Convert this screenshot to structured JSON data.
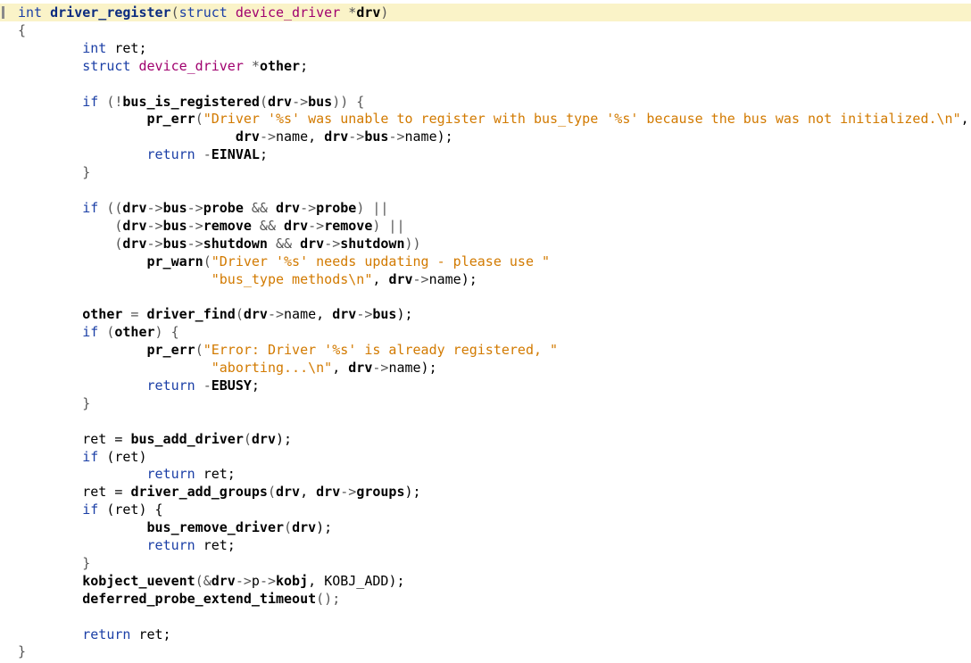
{
  "editor": {
    "colors": {
      "keyword": "#1b3fa6",
      "type_name": "#a0006e",
      "function_definition": "#0b2b80",
      "identifier": "#000000",
      "string": "#d27a00",
      "current_line_highlight": "#faf3c8"
    },
    "lines": [
      [
        {
          "t": "int ",
          "c": "kw"
        },
        {
          "t": "driver_register",
          "c": "fn"
        },
        {
          "t": "(",
          "c": "op"
        },
        {
          "t": "struct ",
          "c": "kw"
        },
        {
          "t": "device_driver ",
          "c": "typ"
        },
        {
          "t": "*",
          "c": "op"
        },
        {
          "t": "drv",
          "c": "id"
        },
        {
          "t": ")",
          "c": "op"
        }
      ],
      [
        {
          "t": "{",
          "c": "op"
        }
      ],
      [
        {
          "t": "        ",
          "c": "pl"
        },
        {
          "t": "int ",
          "c": "kw"
        },
        {
          "t": "ret;",
          "c": "pl"
        }
      ],
      [
        {
          "t": "        ",
          "c": "pl"
        },
        {
          "t": "struct ",
          "c": "kw"
        },
        {
          "t": "device_driver ",
          "c": "typ"
        },
        {
          "t": "*",
          "c": "op"
        },
        {
          "t": "other",
          "c": "id"
        },
        {
          "t": ";",
          "c": "pl"
        }
      ],
      [],
      [
        {
          "t": "        ",
          "c": "pl"
        },
        {
          "t": "if ",
          "c": "kw"
        },
        {
          "t": "(!",
          "c": "op"
        },
        {
          "t": "bus_is_registered",
          "c": "id"
        },
        {
          "t": "(",
          "c": "op"
        },
        {
          "t": "drv",
          "c": "id"
        },
        {
          "t": "->",
          "c": "op"
        },
        {
          "t": "bus",
          "c": "id"
        },
        {
          "t": ")) {",
          "c": "op"
        }
      ],
      [
        {
          "t": "                ",
          "c": "pl"
        },
        {
          "t": "pr_err",
          "c": "id"
        },
        {
          "t": "(",
          "c": "op"
        },
        {
          "t": "\"Driver '%s' was unable to register with bus_type '%s' because the bus was not initialized.\\n\"",
          "c": "str"
        },
        {
          "t": ",",
          "c": "pl"
        }
      ],
      [
        {
          "t": "                           ",
          "c": "pl"
        },
        {
          "t": "drv",
          "c": "id"
        },
        {
          "t": "->",
          "c": "op"
        },
        {
          "t": "name, ",
          "c": "pl"
        },
        {
          "t": "drv",
          "c": "id"
        },
        {
          "t": "->",
          "c": "op"
        },
        {
          "t": "bus",
          "c": "id"
        },
        {
          "t": "->",
          "c": "op"
        },
        {
          "t": "name);",
          "c": "pl"
        }
      ],
      [
        {
          "t": "                ",
          "c": "pl"
        },
        {
          "t": "return ",
          "c": "kw"
        },
        {
          "t": "-",
          "c": "op"
        },
        {
          "t": "EINVAL",
          "c": "id"
        },
        {
          "t": ";",
          "c": "pl"
        }
      ],
      [
        {
          "t": "        ",
          "c": "pl"
        },
        {
          "t": "}",
          "c": "op"
        }
      ],
      [],
      [
        {
          "t": "        ",
          "c": "pl"
        },
        {
          "t": "if ",
          "c": "kw"
        },
        {
          "t": "((",
          "c": "op"
        },
        {
          "t": "drv",
          "c": "id"
        },
        {
          "t": "->",
          "c": "op"
        },
        {
          "t": "bus",
          "c": "id"
        },
        {
          "t": "->",
          "c": "op"
        },
        {
          "t": "probe",
          "c": "id"
        },
        {
          "t": " && ",
          "c": "op"
        },
        {
          "t": "drv",
          "c": "id"
        },
        {
          "t": "->",
          "c": "op"
        },
        {
          "t": "probe",
          "c": "id"
        },
        {
          "t": ") ||",
          "c": "op"
        }
      ],
      [
        {
          "t": "            ",
          "c": "pl"
        },
        {
          "t": "(",
          "c": "op"
        },
        {
          "t": "drv",
          "c": "id"
        },
        {
          "t": "->",
          "c": "op"
        },
        {
          "t": "bus",
          "c": "id"
        },
        {
          "t": "->",
          "c": "op"
        },
        {
          "t": "remove",
          "c": "id"
        },
        {
          "t": " && ",
          "c": "op"
        },
        {
          "t": "drv",
          "c": "id"
        },
        {
          "t": "->",
          "c": "op"
        },
        {
          "t": "remove",
          "c": "id"
        },
        {
          "t": ") ||",
          "c": "op"
        }
      ],
      [
        {
          "t": "            ",
          "c": "pl"
        },
        {
          "t": "(",
          "c": "op"
        },
        {
          "t": "drv",
          "c": "id"
        },
        {
          "t": "->",
          "c": "op"
        },
        {
          "t": "bus",
          "c": "id"
        },
        {
          "t": "->",
          "c": "op"
        },
        {
          "t": "shutdown",
          "c": "id"
        },
        {
          "t": " && ",
          "c": "op"
        },
        {
          "t": "drv",
          "c": "id"
        },
        {
          "t": "->",
          "c": "op"
        },
        {
          "t": "shutdown",
          "c": "id"
        },
        {
          "t": "))",
          "c": "op"
        }
      ],
      [
        {
          "t": "                ",
          "c": "pl"
        },
        {
          "t": "pr_warn",
          "c": "id"
        },
        {
          "t": "(",
          "c": "op"
        },
        {
          "t": "\"Driver '%s' needs updating - please use \"",
          "c": "str"
        }
      ],
      [
        {
          "t": "                        ",
          "c": "pl"
        },
        {
          "t": "\"bus_type methods\\n\"",
          "c": "str"
        },
        {
          "t": ", ",
          "c": "pl"
        },
        {
          "t": "drv",
          "c": "id"
        },
        {
          "t": "->",
          "c": "op"
        },
        {
          "t": "name);",
          "c": "pl"
        }
      ],
      [],
      [
        {
          "t": "        ",
          "c": "pl"
        },
        {
          "t": "other",
          "c": "id"
        },
        {
          "t": " = ",
          "c": "op"
        },
        {
          "t": "driver_find",
          "c": "id"
        },
        {
          "t": "(",
          "c": "op"
        },
        {
          "t": "drv",
          "c": "id"
        },
        {
          "t": "->",
          "c": "op"
        },
        {
          "t": "name, ",
          "c": "pl"
        },
        {
          "t": "drv",
          "c": "id"
        },
        {
          "t": "->",
          "c": "op"
        },
        {
          "t": "bus",
          "c": "id"
        },
        {
          "t": ");",
          "c": "pl"
        }
      ],
      [
        {
          "t": "        ",
          "c": "pl"
        },
        {
          "t": "if ",
          "c": "kw"
        },
        {
          "t": "(",
          "c": "op"
        },
        {
          "t": "other",
          "c": "id"
        },
        {
          "t": ") {",
          "c": "op"
        }
      ],
      [
        {
          "t": "                ",
          "c": "pl"
        },
        {
          "t": "pr_err",
          "c": "id"
        },
        {
          "t": "(",
          "c": "op"
        },
        {
          "t": "\"Error: Driver '%s' is already registered, \"",
          "c": "str"
        }
      ],
      [
        {
          "t": "                        ",
          "c": "pl"
        },
        {
          "t": "\"aborting...\\n\"",
          "c": "str"
        },
        {
          "t": ", ",
          "c": "pl"
        },
        {
          "t": "drv",
          "c": "id"
        },
        {
          "t": "->",
          "c": "op"
        },
        {
          "t": "name);",
          "c": "pl"
        }
      ],
      [
        {
          "t": "                ",
          "c": "pl"
        },
        {
          "t": "return ",
          "c": "kw"
        },
        {
          "t": "-",
          "c": "op"
        },
        {
          "t": "EBUSY",
          "c": "id"
        },
        {
          "t": ";",
          "c": "pl"
        }
      ],
      [
        {
          "t": "        ",
          "c": "pl"
        },
        {
          "t": "}",
          "c": "op"
        }
      ],
      [],
      [
        {
          "t": "        ",
          "c": "pl"
        },
        {
          "t": "ret = ",
          "c": "pl"
        },
        {
          "t": "bus_add_driver",
          "c": "id"
        },
        {
          "t": "(",
          "c": "op"
        },
        {
          "t": "drv",
          "c": "id"
        },
        {
          "t": ");",
          "c": "pl"
        }
      ],
      [
        {
          "t": "        ",
          "c": "pl"
        },
        {
          "t": "if ",
          "c": "kw"
        },
        {
          "t": "(ret)",
          "c": "pl"
        }
      ],
      [
        {
          "t": "                ",
          "c": "pl"
        },
        {
          "t": "return ",
          "c": "kw"
        },
        {
          "t": "ret;",
          "c": "pl"
        }
      ],
      [
        {
          "t": "        ",
          "c": "pl"
        },
        {
          "t": "ret = ",
          "c": "pl"
        },
        {
          "t": "driver_add_groups",
          "c": "id"
        },
        {
          "t": "(",
          "c": "op"
        },
        {
          "t": "drv",
          "c": "id"
        },
        {
          "t": ", ",
          "c": "pl"
        },
        {
          "t": "drv",
          "c": "id"
        },
        {
          "t": "->",
          "c": "op"
        },
        {
          "t": "groups",
          "c": "id"
        },
        {
          "t": ");",
          "c": "pl"
        }
      ],
      [
        {
          "t": "        ",
          "c": "pl"
        },
        {
          "t": "if ",
          "c": "kw"
        },
        {
          "t": "(ret) {",
          "c": "pl"
        }
      ],
      [
        {
          "t": "                ",
          "c": "pl"
        },
        {
          "t": "bus_remove_driver",
          "c": "id"
        },
        {
          "t": "(",
          "c": "op"
        },
        {
          "t": "drv",
          "c": "id"
        },
        {
          "t": ");",
          "c": "pl"
        }
      ],
      [
        {
          "t": "                ",
          "c": "pl"
        },
        {
          "t": "return ",
          "c": "kw"
        },
        {
          "t": "ret;",
          "c": "pl"
        }
      ],
      [
        {
          "t": "        ",
          "c": "pl"
        },
        {
          "t": "}",
          "c": "op"
        }
      ],
      [
        {
          "t": "        ",
          "c": "pl"
        },
        {
          "t": "kobject_uevent",
          "c": "id"
        },
        {
          "t": "(&",
          "c": "op"
        },
        {
          "t": "drv",
          "c": "id"
        },
        {
          "t": "->",
          "c": "op"
        },
        {
          "t": "p",
          "c": "pl"
        },
        {
          "t": "->",
          "c": "op"
        },
        {
          "t": "kobj",
          "c": "id"
        },
        {
          "t": ", ",
          "c": "pl"
        },
        {
          "t": "KOBJ_ADD",
          "c": "pl"
        },
        {
          "t": ");",
          "c": "pl"
        }
      ],
      [
        {
          "t": "        ",
          "c": "pl"
        },
        {
          "t": "deferred_probe_extend_timeout",
          "c": "id"
        },
        {
          "t": "();",
          "c": "op"
        }
      ],
      [],
      [
        {
          "t": "        ",
          "c": "pl"
        },
        {
          "t": "return ",
          "c": "kw"
        },
        {
          "t": "ret;",
          "c": "pl"
        }
      ],
      [
        {
          "t": "}",
          "c": "op"
        }
      ]
    ]
  }
}
